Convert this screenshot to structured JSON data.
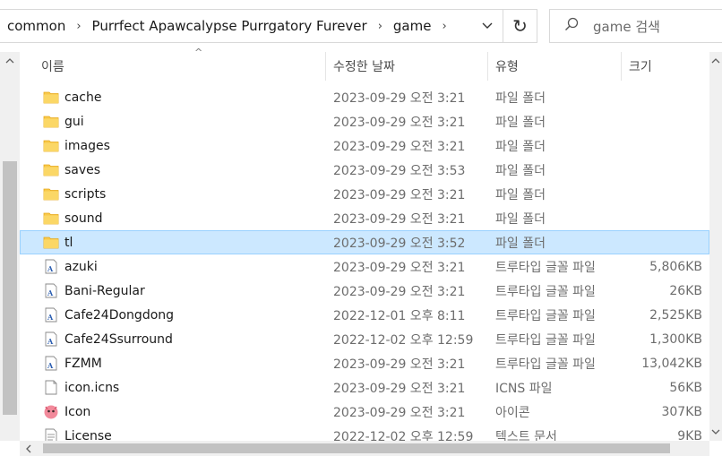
{
  "address": {
    "crumbs": [
      "common",
      "Purrfect Apawcalypse Purrgatory Furever",
      "game"
    ],
    "separator": "›",
    "dropdown_glyph": "⌄",
    "refresh_glyph": "↻"
  },
  "search": {
    "placeholder": "game 검색",
    "icon": "🔍"
  },
  "columns": {
    "name": "이름",
    "date": "수정한 날짜",
    "type": "유형",
    "size": "크기",
    "sort_indicator": "^"
  },
  "rows": [
    {
      "icon": "folder",
      "name": "cache",
      "date": "2023-09-29 오전 3:21",
      "type": "파일 폴더",
      "size": ""
    },
    {
      "icon": "folder",
      "name": "gui",
      "date": "2023-09-29 오전 3:21",
      "type": "파일 폴더",
      "size": ""
    },
    {
      "icon": "folder",
      "name": "images",
      "date": "2023-09-29 오전 3:21",
      "type": "파일 폴더",
      "size": ""
    },
    {
      "icon": "folder",
      "name": "saves",
      "date": "2023-09-29 오전 3:53",
      "type": "파일 폴더",
      "size": ""
    },
    {
      "icon": "folder",
      "name": "scripts",
      "date": "2023-09-29 오전 3:21",
      "type": "파일 폴더",
      "size": ""
    },
    {
      "icon": "folder",
      "name": "sound",
      "date": "2023-09-29 오전 3:21",
      "type": "파일 폴더",
      "size": ""
    },
    {
      "icon": "folder",
      "name": "tl",
      "date": "2023-09-29 오전 3:52",
      "type": "파일 폴더",
      "size": "",
      "selected": true
    },
    {
      "icon": "font",
      "name": "azuki",
      "date": "2023-09-29 오전 3:21",
      "type": "트루타입 글꼴 파일",
      "size": "5,806KB"
    },
    {
      "icon": "font",
      "name": "Bani-Regular",
      "date": "2023-09-29 오전 3:21",
      "type": "트루타입 글꼴 파일",
      "size": "26KB"
    },
    {
      "icon": "font",
      "name": "Cafe24Dongdong",
      "date": "2022-12-01 오후 8:11",
      "type": "트루타입 글꼴 파일",
      "size": "2,525KB"
    },
    {
      "icon": "font",
      "name": "Cafe24Ssurround",
      "date": "2022-12-02 오후 12:59",
      "type": "트루타입 글꼴 파일",
      "size": "1,300KB"
    },
    {
      "icon": "font",
      "name": "FZMM",
      "date": "2023-09-29 오전 3:21",
      "type": "트루타입 글꼴 파일",
      "size": "13,042KB"
    },
    {
      "icon": "file",
      "name": "icon.icns",
      "date": "2023-09-29 오전 3:21",
      "type": "ICNS 파일",
      "size": "56KB"
    },
    {
      "icon": "app-icon",
      "name": "Icon",
      "date": "2023-09-29 오전 3:21",
      "type": "아이콘",
      "size": "307KB"
    },
    {
      "icon": "text",
      "name": "License",
      "date": "2022-12-02 오후 12:59",
      "type": "텍스트 문서",
      "size": "9KB"
    }
  ],
  "colors": {
    "folder": "#f8c94b",
    "folder_dark": "#e6a817",
    "selection": "#cce8ff",
    "font_icon": "#2a5db0"
  }
}
